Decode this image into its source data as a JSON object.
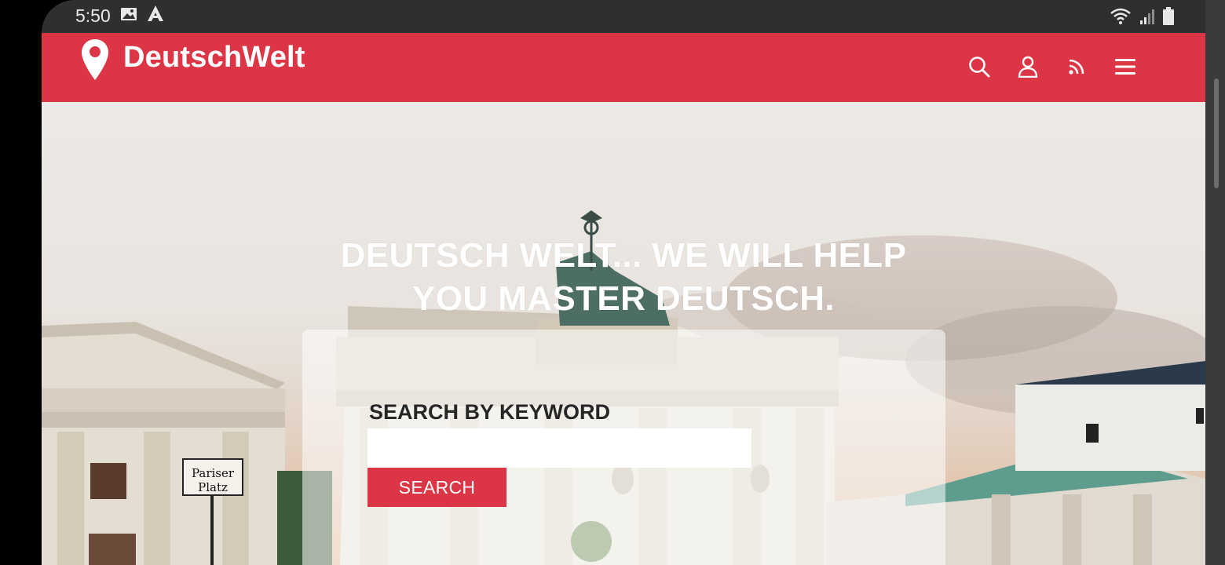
{
  "status_bar": {
    "time": "5:50",
    "left_icons": [
      "image-icon",
      "a-notification-icon"
    ],
    "right_icons": [
      "wifi-icon",
      "signal-icon",
      "battery-icon"
    ]
  },
  "app_bar": {
    "brand": "DeutschWelt",
    "brand_icon": "location-pin-icon",
    "actions": [
      "search-icon",
      "user-icon",
      "rss-icon",
      "menu-icon"
    ],
    "color": "#dc3545"
  },
  "hero": {
    "title": "DEUTSCH WELT... WE WILL HELP YOU MASTER DEUTSCH.",
    "sign_line1": "Pariser",
    "sign_line2": "Platz"
  },
  "search": {
    "label": "SEARCH BY KEYWORD",
    "value": "",
    "placeholder": "",
    "button_label": "SEARCH"
  }
}
